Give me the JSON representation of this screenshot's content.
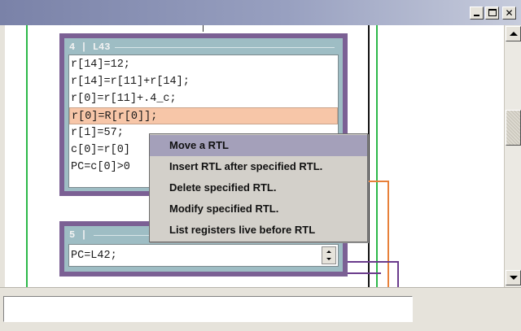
{
  "window": {
    "minimize_icon": "minimize-icon",
    "maximize_icon": "maximize-icon",
    "close_icon": "close-icon",
    "title_gradient_start": "#7a82a8",
    "title_gradient_end": "#c7ccdc"
  },
  "block_4": {
    "header": "4 | L43",
    "lines": [
      "r[14]=12;",
      "r[14]=r[11]+r[14];",
      "r[0]=r[11]+.4_c;",
      "r[0]=R[r[0]];",
      "r[1]=57;",
      "c[0]=r[0]",
      "PC=c[0]>0"
    ],
    "selected_index": 3
  },
  "block_5": {
    "header": "5 |",
    "lines": [
      "PC=L42;"
    ]
  },
  "context_menu": {
    "items": [
      "Move a RTL",
      "Insert RTL after specified RTL.",
      "Delete specified RTL.",
      "Modify specified RTL.",
      "List registers live before RTL"
    ],
    "highlighted_index": 0
  },
  "scrollbar": {
    "up_icon": "arrow-up-icon",
    "down_icon": "arrow-down-icon"
  },
  "status": {
    "value": ""
  },
  "colors": {
    "block_border": "#7b6094",
    "block_fill": "#9ebdc4",
    "selected_line": "#f7c6a8",
    "menu_highlight": "#a4a0ba",
    "edge_green": "#2db84a",
    "edge_orange": "#e8803a",
    "edge_purple": "#6a3b8c"
  }
}
